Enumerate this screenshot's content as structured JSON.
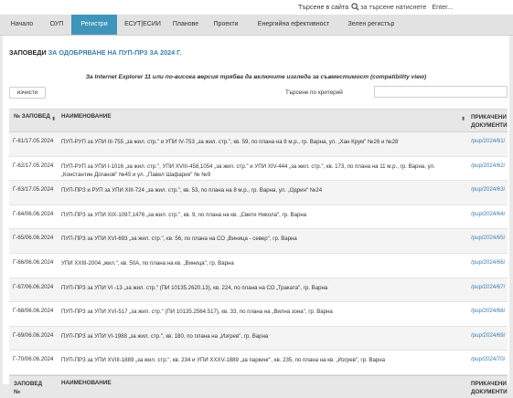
{
  "search": {
    "label": "Търсене в сайта",
    "placeholder": "за търсене натиснете   Enter..."
  },
  "nav": {
    "items": [
      {
        "label": "Начало"
      },
      {
        "label": "ОУП"
      },
      {
        "label": "Регистри",
        "active": true
      },
      {
        "label": "ЕСУТ|ЕСИИ"
      },
      {
        "label": "Планове"
      },
      {
        "label": "Проекти"
      },
      {
        "label": "Енергийна ефективност"
      },
      {
        "label": "Зелен регистър"
      }
    ]
  },
  "page": {
    "title_prefix": "ЗАПОВЕДИ",
    "title_rest": "ЗА ОДОБРЯВАНЕ НА ПУП-ПРЗ ЗА 2024 Г.",
    "notice": "За Internet Explorer 11 или по-висока версия трябва да включите изгледа за съвместимост (compatibility view)",
    "clear_button": "изчисти",
    "filter_label": "Търсене по критерий",
    "filter_value": ""
  },
  "table": {
    "col_number": "№ ЗАПОВЕД",
    "col_name": "НАИМЕНОВАНИЕ",
    "col_docs_line1": "ПРИКАЧЕНИ",
    "col_docs_line2": "ДОКУМЕНТИ",
    "footer_col_number_line1": "ЗАПОВЕД",
    "footer_col_number_line2": "№",
    "rows": [
      {
        "number": "Г-61/17.05.2024",
        "name": "ПУП-РУП за УПИ III-755 „за жил. стр.\" и УПИ IV-753 „за жил. стр.\", кв. 59, по плана на 8 м.р., гр. Варна, ул. „Хан Крум\" №26 и №28",
        "doc": "/pup/2024/61/"
      },
      {
        "number": "Г-62/17.05.2024",
        "name": "ПУП-РУП за УПИ I-1016 „за жил. стр.\", УПИ XVIII-458,1054 „за жил. стр.\" и УПИ XIV-444 „за жил. стр.\", кв. 173, по плана на 11 м.р., гр. Варна, ул. „Константин Доганов\" №45 и ул. „Павел Шафарик\" № №9",
        "doc": "/pup/2024/62/"
      },
      {
        "number": "Г-63/17.05.2024",
        "name": "ПУП-ПРЗ и РУП за УПИ XIII-724 „за жил. стр.\", кв. 53, по плана на 8 м.р., гр. Варна, ул. „Одрин\" №24",
        "doc": "/pup/2024/63/"
      },
      {
        "number": "Г-64/06.06.2024",
        "name": "ПУП-ПРЗ за УПИ XIX-1097,1476 „за жил. стр.\", кв. 9, по плана на кв. „Свети Никола\", гр. Варна",
        "doc": "/pup/2024/64/"
      },
      {
        "number": "Г-65/06.06.2024",
        "name": "ПУП-ПРЗ за УПИ XVI-693 „за жил. стр.\", кв. 56, по плана на СО „Виница - север\", гр. Варна",
        "doc": "/pup/2024/65/"
      },
      {
        "number": "Г-66/06.06.2024",
        "name": "УПИ XXIII-2004 „жил.\", кв. 50А, по плана на кв. „Виница\", гр. Варна",
        "doc": "/pup/2024/66/"
      },
      {
        "number": "Г-67/06.06.2024",
        "name": "ПУП-ПРЗ за УПИ VI -13 „за жил. стр.\" (ПИ 10135.2620.13), кв. 224, по плана на СО „Траката\", гр. Варна",
        "doc": "/pup/2024/67/"
      },
      {
        "number": "Г-68/06.06.2024",
        "name": "ПУП-ПРЗ за УПИ XVI-517 „за жил. стр.\" (ПИ 10135.2564.517), кв. 33, по плана на „Вилна зона\", гр. Варна",
        "doc": "/pup/2024/68/"
      },
      {
        "number": "Г-69/06.06.2024",
        "name": "ПУП-ПРЗ за УПИ VI-1988 „за жил. стр.\", кв. 180, по плана на „Изгрев\", гр. Варна",
        "doc": "/pup/2024/69/"
      },
      {
        "number": "Г-70/06.06.2024",
        "name": "ПУП-ПРЗ за УПИ XVIII-1889 „за жил. стр.\", кв. 234 и УПИ XXXV-1889 „за паркинг\", кв. 235, по плана на кв. „Изгрев\", гр. Варна",
        "doc": "/pup/2024/70/"
      }
    ]
  },
  "colors": {
    "accent": "#3f95b9",
    "link": "#3a7ea8"
  }
}
